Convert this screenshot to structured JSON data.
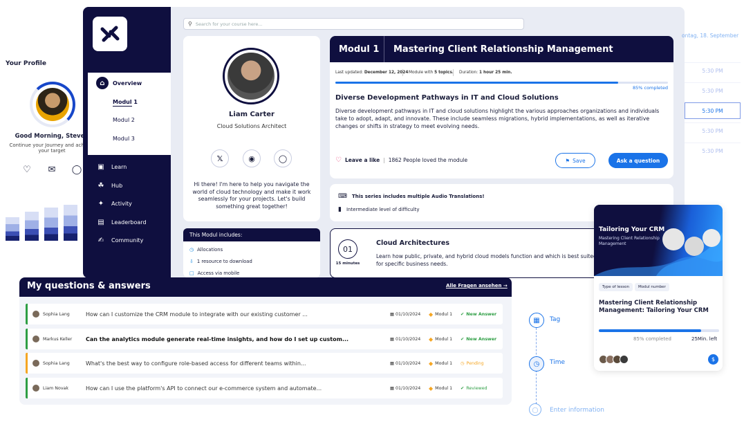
{
  "profile": {
    "heading": "Your Profile",
    "greeting": "Good Morning, Steven",
    "subtitle": "Continue your Journey and achieve your target"
  },
  "profile_icons": [
    "bell-icon",
    "mail-icon",
    "user-icon"
  ],
  "search": {
    "placeholder": "Search for your course here..."
  },
  "sidebar": {
    "overview": "Overview",
    "modules": [
      "Modul 1",
      "Modul 2",
      "Modul 3"
    ],
    "nav": [
      {
        "label": "Learn",
        "icon": "learn-icon"
      },
      {
        "label": "Hub",
        "icon": "hub-icon"
      },
      {
        "label": "Activity",
        "icon": "activity-icon"
      },
      {
        "label": "Leaderboard",
        "icon": "leaderboard-icon"
      },
      {
        "label": "Community",
        "icon": "community-icon"
      }
    ]
  },
  "instructor": {
    "name": "Liam Carter",
    "role": "Cloud Solutions Architect",
    "bio": "Hi there! I'm here to help you navigate the world of cloud technology and make it work seamlessly for your projects. Let's build something great together!",
    "includes_title": "This Modul includes:",
    "includes": [
      "Allocations",
      "1 resource to download",
      "Access via mobile"
    ]
  },
  "module": {
    "number": "Modul 1",
    "title": "Mastering Client Relationship Management",
    "last_updated_label": "Last updated:",
    "last_updated": "December 12, 2024",
    "topics_label": "Module with",
    "topics": "5 topics.",
    "duration_label": "Duration:",
    "duration": "1 hour 25 min.",
    "progress": 85,
    "progress_text": "85% completed",
    "article_title": "Diverse Development Pathways in IT and Cloud Solutions",
    "article_body": "Diverse development pathways in IT and cloud solutions highlight the various approaches organizations and individuals take to adopt, adapt, and innovate. These include seamless migrations, hybrid implementations, as well as iterative changes or shifts in strategy to meet evolving needs.",
    "like_label": "Leave a like",
    "like_count": "1862 People loved the module",
    "save_label": "Save",
    "ask_label": "Ask a question"
  },
  "series": {
    "line1": "This series includes multiple Audio Translations!",
    "line2": "Intermediate level of difficulty"
  },
  "architecture": {
    "num": "01",
    "minutes": "15 minutes",
    "title": "Cloud Architectures",
    "body": "Learn how public, private, and hybrid cloud models function and which is best suited for specific business needs."
  },
  "schedule": {
    "date": "ontag, 18. September",
    "slots": [
      "5:30 PM",
      "5:30 PM",
      "5:30 PM",
      "5:30 PM",
      "5:30 PM"
    ],
    "selected_index": 2
  },
  "questions": {
    "title": "My questions & answers",
    "see_all": "Alle Fragen ansehen →",
    "rows": [
      {
        "name": "Sophia Lang",
        "text": "How can I customize the CRM module to integrate with our existing customer ...",
        "date": "01/10/2024",
        "module": "Modul 1",
        "status": "New Answer",
        "color": "#2e9e44"
      },
      {
        "name": "Markus Keller",
        "text": "Can the analytics module generate real-time insights, and how do I set up custom...",
        "date": "01/10/2024",
        "module": "Modul 1",
        "status": "New Answer",
        "color": "#2e9e44"
      },
      {
        "name": "Sophia Lang",
        "text": "What's the best way to configure role-based access for different teams within...",
        "date": "01/10/2024",
        "module": "Modul 1",
        "status": "Pending",
        "color": "#f5a623"
      },
      {
        "name": "Liam Novak",
        "text": "How can I use the platform's API to connect our e-commerce system and automate...",
        "date": "01/10/2024",
        "module": "Modul 1",
        "status": "Reviewed",
        "color": "#2e9e44"
      }
    ]
  },
  "timeline": {
    "tag": "Tag",
    "time": "Time",
    "enter": "Enter information"
  },
  "course_card": {
    "img_title": "Tailoring Your CRM",
    "img_sub": "Mastering Client Relationship Management",
    "tag1": "Type of lesson",
    "tag2": "Modul number",
    "title": "Mastering Client Relationship Management: Tailoring Your CRM",
    "progress": 85,
    "progress_text": "85% completed",
    "time_left": "25Min. left"
  }
}
